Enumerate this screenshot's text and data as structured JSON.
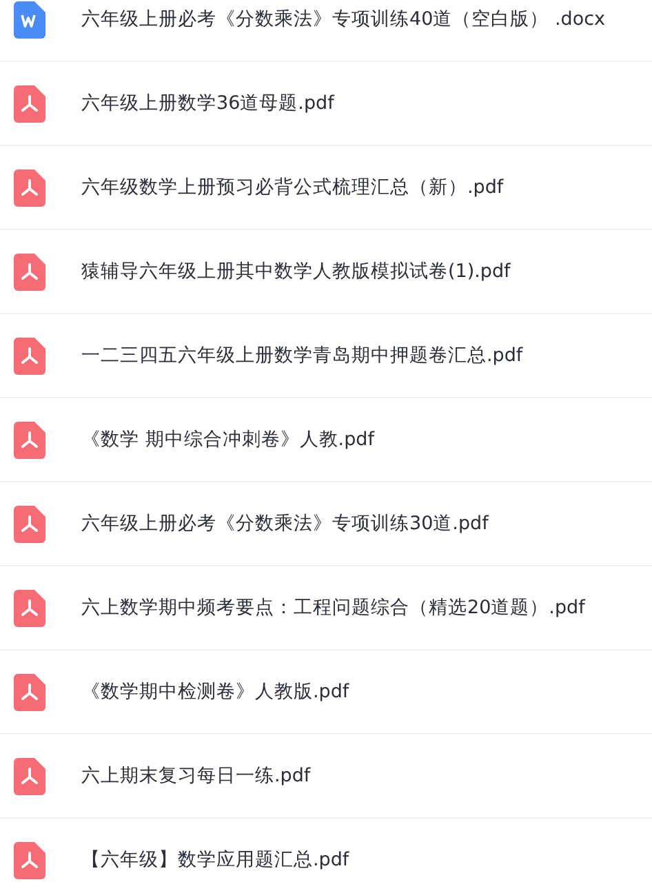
{
  "files": [
    {
      "kind": "word",
      "name": "六年级上册必考《分数乘法》专项训练40道（空白版） .docx"
    },
    {
      "kind": "pdf",
      "name": "六年级上册数学36道母题.pdf"
    },
    {
      "kind": "pdf",
      "name": "六年级数学上册预习必背公式梳理汇总（新）.pdf"
    },
    {
      "kind": "pdf",
      "name": "猿辅导六年级上册其中数学人教版模拟试卷(1).pdf"
    },
    {
      "kind": "pdf",
      "name": "一二三四五六年级上册数学青岛期中押题卷汇总.pdf"
    },
    {
      "kind": "pdf",
      "name": "《数学 期中综合冲刺卷》人教.pdf"
    },
    {
      "kind": "pdf",
      "name": "六年级上册必考《分数乘法》专项训练30道.pdf"
    },
    {
      "kind": "pdf",
      "name": "六上数学期中频考要点：工程问题综合（精选20道题）.pdf"
    },
    {
      "kind": "pdf",
      "name": "《数学期中检测卷》人教版.pdf"
    },
    {
      "kind": "pdf",
      "name": "六上期末复习每日一练.pdf"
    },
    {
      "kind": "pdf",
      "name": "【六年级】数学应用题汇总.pdf"
    }
  ]
}
